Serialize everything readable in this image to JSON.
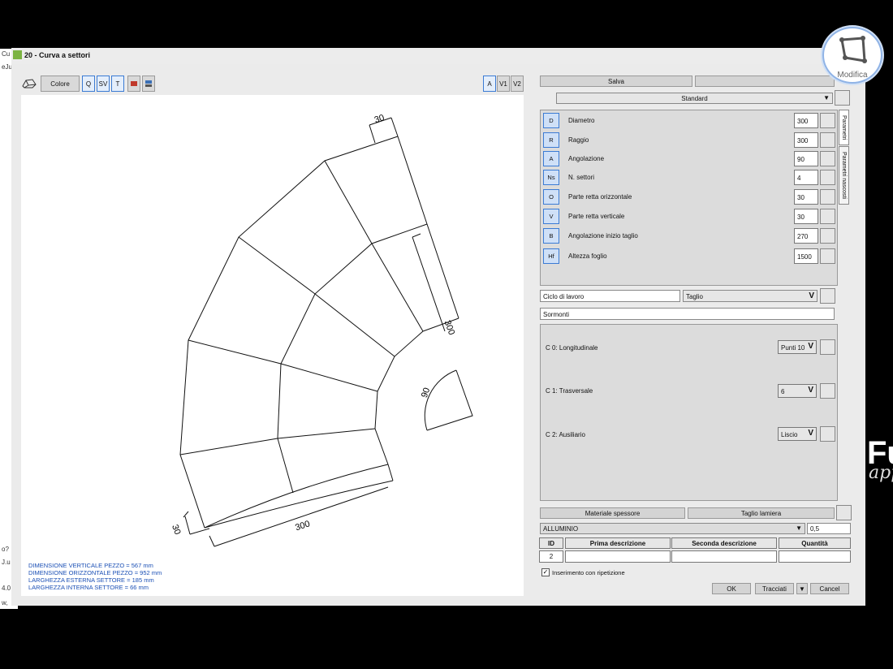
{
  "window": {
    "title": "20 - Curva a settori"
  },
  "left_strip": {
    "t1": "Cu",
    "t2": "eJu",
    "t3": "o?",
    "t4": "J.u",
    "t5": "4.0",
    "t6": "w,"
  },
  "toolbar": {
    "colore": "Colore",
    "q": "Q",
    "sv": "SV",
    "t": "T",
    "a": "A",
    "v1": "V1",
    "v2": "V2"
  },
  "drawing": {
    "dim_top": "30",
    "dim_right": "300",
    "dim_angle": "90",
    "dim_bottom_left": "30",
    "dim_bottom": "300"
  },
  "info": {
    "line1": "DIMENSIONE VERTICALE PEZZO = 567 mm",
    "line2": "DIMENSIONE ORIZZONTALE PEZZO = 952 mm",
    "line3": "LARGHEZZA ESTERNA SETTORE = 185 mm",
    "line4": "LARGHEZZA INTERNA SETTORE = 66 mm"
  },
  "right": {
    "salva": "Salva",
    "standard": "Standard",
    "tab_parametri": "Parametri",
    "tab_nascosti": "Parametri nascosti",
    "params": [
      {
        "code": "D",
        "label": "Diametro",
        "value": "300"
      },
      {
        "code": "R",
        "label": "Raggio",
        "value": "300"
      },
      {
        "code": "A",
        "label": "Angolazione",
        "value": "90"
      },
      {
        "code": "Ns",
        "label": "N. settori",
        "value": "4"
      },
      {
        "code": "O",
        "label": "Parte retta orizzontale",
        "value": "30"
      },
      {
        "code": "V",
        "label": "Parte retta verticale",
        "value": "30"
      },
      {
        "code": "B",
        "label": "Angolazione inizio taglio",
        "value": "270"
      },
      {
        "code": "Hf",
        "label": "Altezza foglio",
        "value": "1500"
      }
    ],
    "ciclo_label": "Ciclo di lavoro",
    "ciclo_value": "Taglio",
    "sormonti": "Sormonti",
    "cuts": [
      {
        "label": "C 0: Longitudinale",
        "value": "Punti 10"
      },
      {
        "label": "C 1: Trasversale",
        "value": "6"
      },
      {
        "label": "C 2: Ausiliario",
        "value": "Liscio"
      }
    ],
    "materiale_spessore": "Materiale spessore",
    "taglio_lamiera": "Taglio lamiera",
    "material": "ALLUMINIO",
    "thickness": "0,5",
    "table_headers": {
      "id": "ID",
      "prima": "Prima descrizione",
      "seconda": "Seconda descrizione",
      "quantita": "Quantità"
    },
    "table_row": {
      "id": "2",
      "prima": "",
      "seconda": "",
      "quantita": ""
    },
    "inserimento": "Inserimento con ripetizione",
    "ok": "OK",
    "tracciati": "Tracciati",
    "cancel": "Cancel"
  },
  "badge": {
    "label": "Modifica"
  },
  "bg": {
    "f": "Fu",
    "app": "app"
  }
}
